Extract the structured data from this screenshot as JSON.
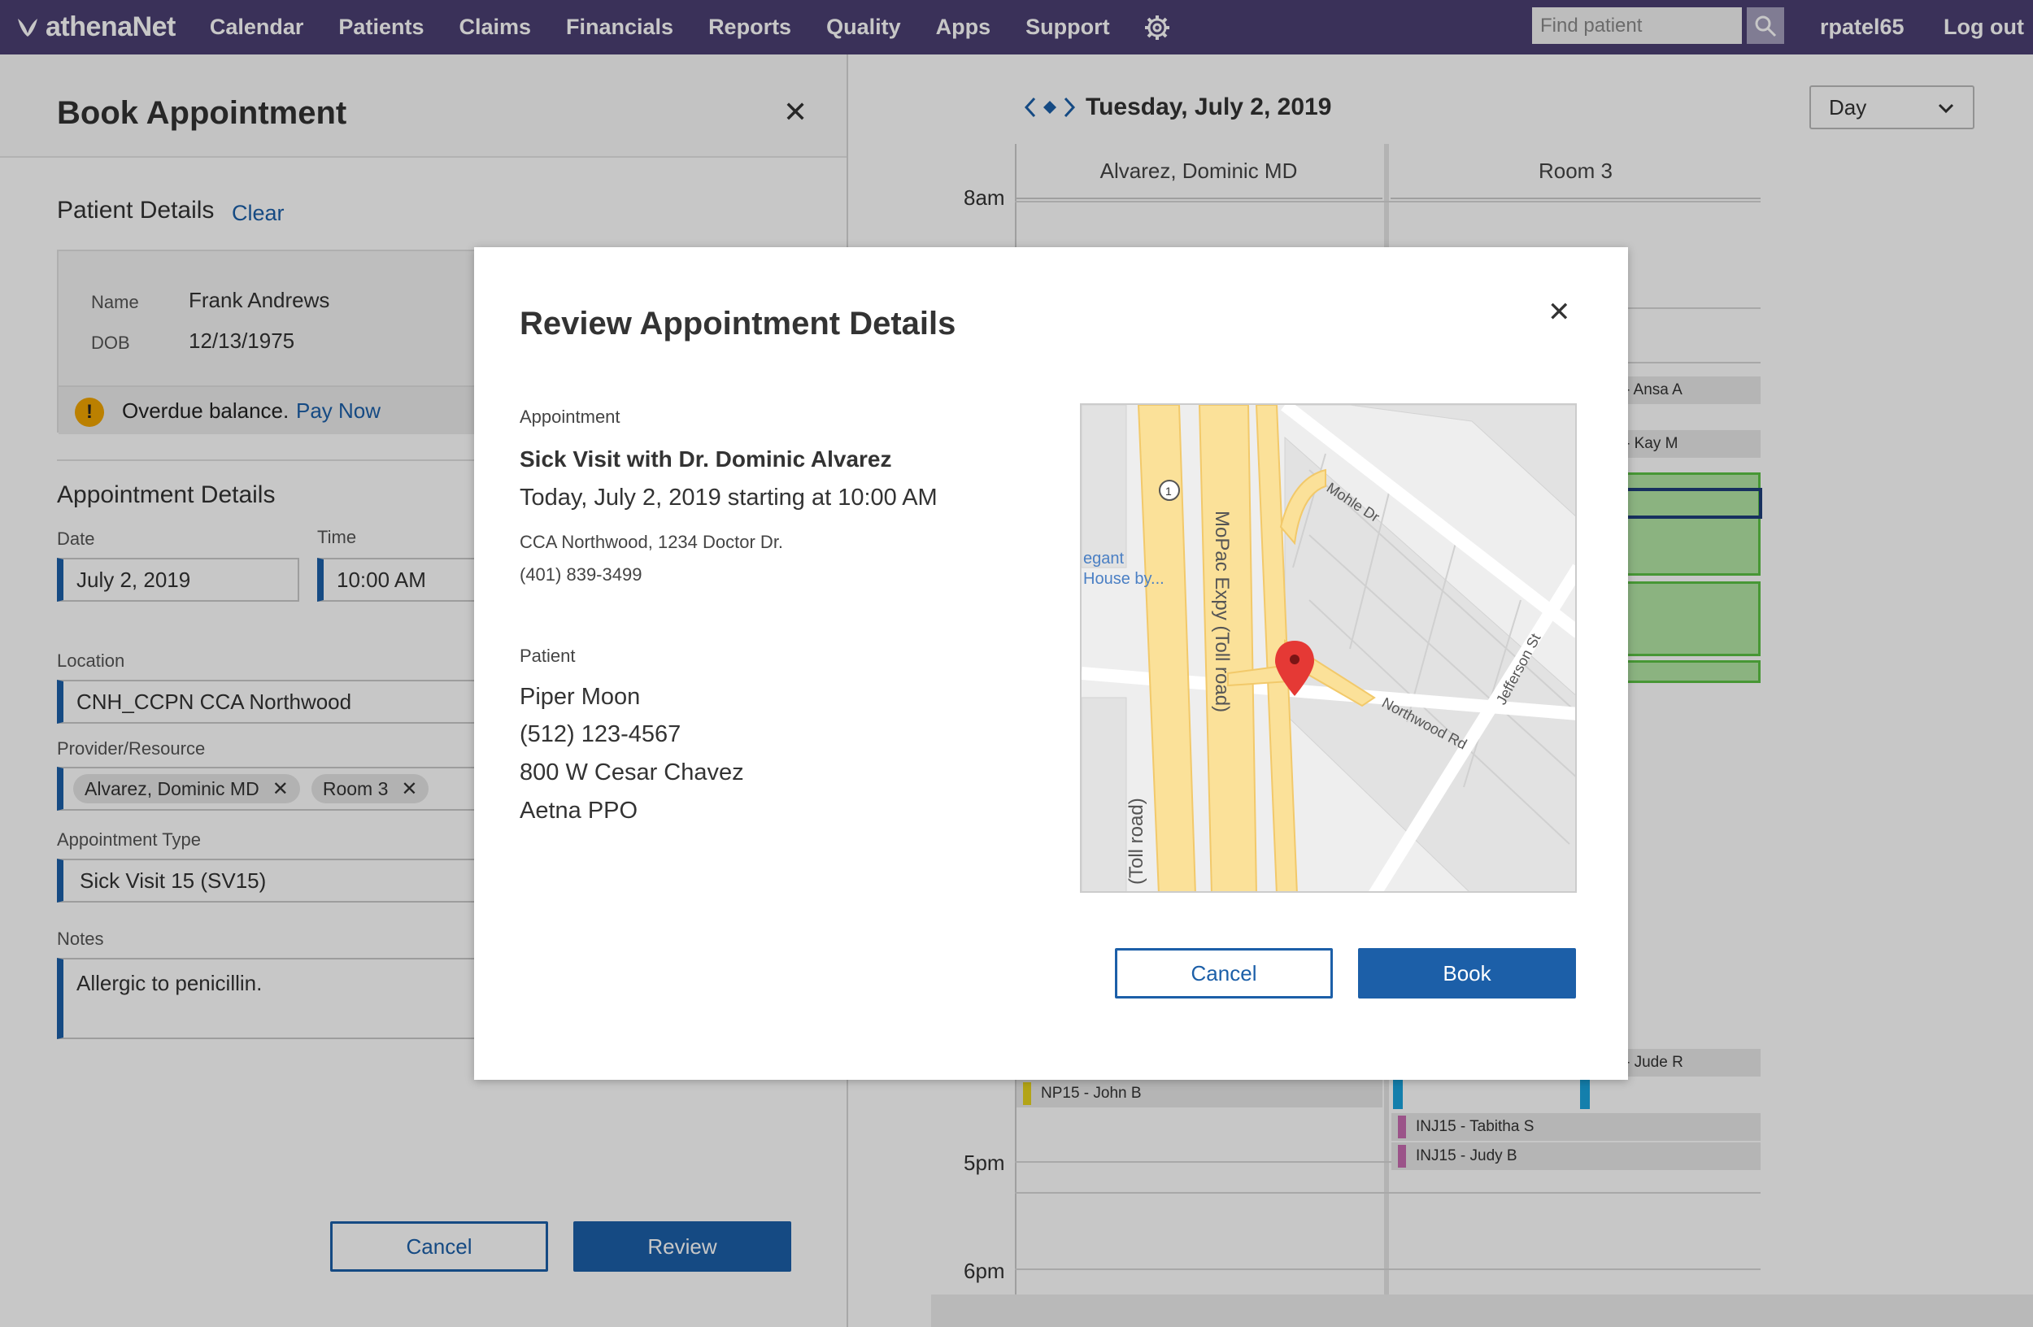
{
  "nav": {
    "brand": "athenaNet",
    "items": [
      "Calendar",
      "Patients",
      "Claims",
      "Financials",
      "Reports",
      "Quality",
      "Apps",
      "Support"
    ],
    "search_placeholder": "Find patient",
    "username": "rpatel65",
    "logout": "Log out"
  },
  "book_panel": {
    "title": "Book Appointment",
    "patient_section": "Patient Details",
    "clear_label": "Clear",
    "name_label": "Name",
    "name_value": "Frank Andrews",
    "dob_label": "DOB",
    "dob_value": "12/13/1975",
    "overdue_text": "Overdue balance.",
    "pay_now": "Pay Now",
    "appt_section": "Appointment Details",
    "date_label": "Date",
    "date_value": "July 2, 2019",
    "time_label": "Time",
    "time_value": "10:00 AM",
    "location_label": "Location",
    "location_value": "CNH_CCPN CCA Northwood",
    "provider_label": "Provider/Resource",
    "providers": [
      "Alvarez, Dominic MD",
      "Room 3"
    ],
    "appt_type_label": "Appointment Type",
    "appt_type_value": "Sick Visit 15 (SV15)",
    "notes_label": "Notes",
    "notes_value": "Allergic to penicillin.",
    "cancel_label": "Cancel",
    "review_label": "Review"
  },
  "calendar": {
    "date": "Tuesday, July 2, 2019",
    "view": "Day",
    "columns": [
      "Alvarez, Dominic MD",
      "Room 3"
    ],
    "times": [
      "8am",
      "5pm",
      "6pm"
    ],
    "appointments": [
      {
        "label": "- Ansa A",
        "color": "#e8e8e8"
      },
      {
        "label": "- Kay M",
        "color": "#e8e8e8"
      },
      {
        "label": "- Jude R",
        "color": "#e8e8e8"
      },
      {
        "label": "NP15 - John B",
        "tag_color": "#e6d21e"
      },
      {
        "label": "INJ15 - Tabitha S",
        "tag_color": "#c76bb0"
      },
      {
        "label": "INJ15 - Judy B",
        "tag_color": "#c76bb0"
      }
    ]
  },
  "modal": {
    "title": "Review Appointment Details",
    "appointment_label": "Appointment",
    "visit": "Sick Visit with Dr. Dominic Alvarez",
    "when": "Today, July 2, 2019 starting at 10:00 AM",
    "address": "CCA Northwood, 1234 Doctor Dr.",
    "phone": "(401) 839-3499",
    "patient_label": "Patient",
    "patient_name": "Piper Moon",
    "patient_phone": "(512) 123-4567",
    "patient_address": "800 W Cesar Chavez",
    "insurance": "Aetna PPO",
    "map_labels": {
      "street1": "Mohle Dr",
      "street2": "Northwood Rd",
      "street3": "Jefferson St",
      "highway": "MoPac Expy (Toll road)",
      "highway2": "(Toll road)",
      "poi": "egant",
      "poi2": "House by...",
      "route": "1"
    },
    "cancel_label": "Cancel",
    "book_label": "Book"
  },
  "colors": {
    "nav_bg": "#4b3f72",
    "primary": "#1c5fa8",
    "warning": "#f0a400",
    "map_pin": "#e53935"
  }
}
